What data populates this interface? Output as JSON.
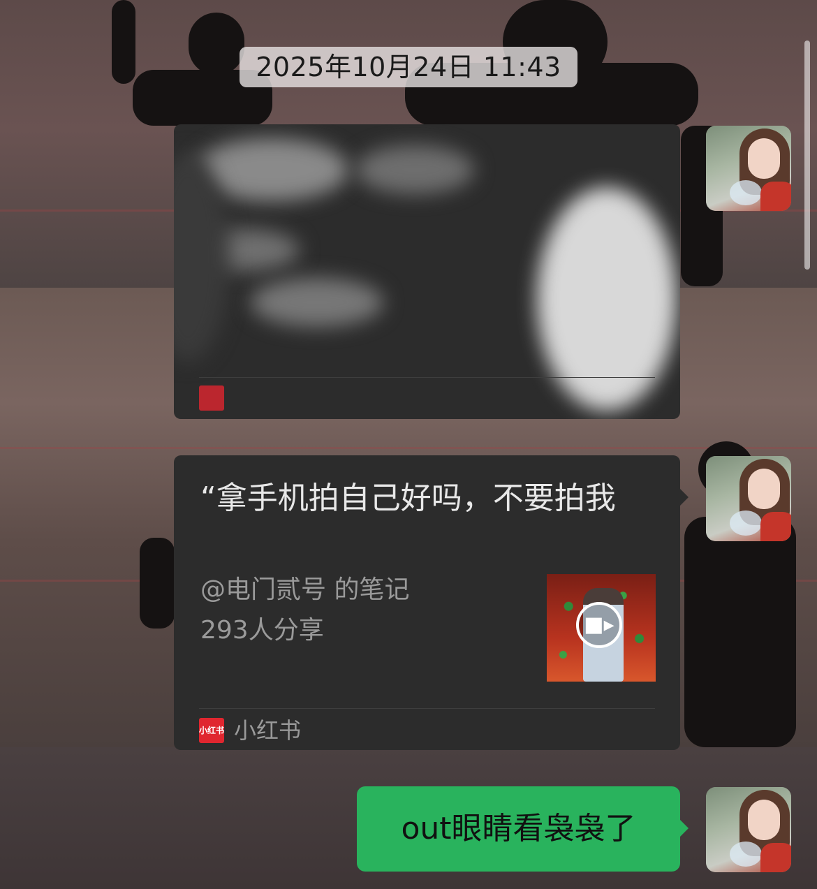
{
  "chat": {
    "timestamp": "2025年10月24日 11:43"
  },
  "messages": [
    {
      "type": "shared-note-redacted",
      "redacted": true
    },
    {
      "type": "shared-note",
      "title": "“拿手机拍自己好吗，不要拍我",
      "author": "@电门贰号 的笔记",
      "shares": "293人分享",
      "source_name": "小红书",
      "source_logo_text": "小红书",
      "thumbnail_icon": "video-camera-icon"
    },
    {
      "type": "text",
      "text": "out眼睛看袅袅了"
    }
  ],
  "colors": {
    "card_bg": "#2c2c2c",
    "bubble_green": "#29b35d",
    "brand_red": "#e0262f"
  }
}
